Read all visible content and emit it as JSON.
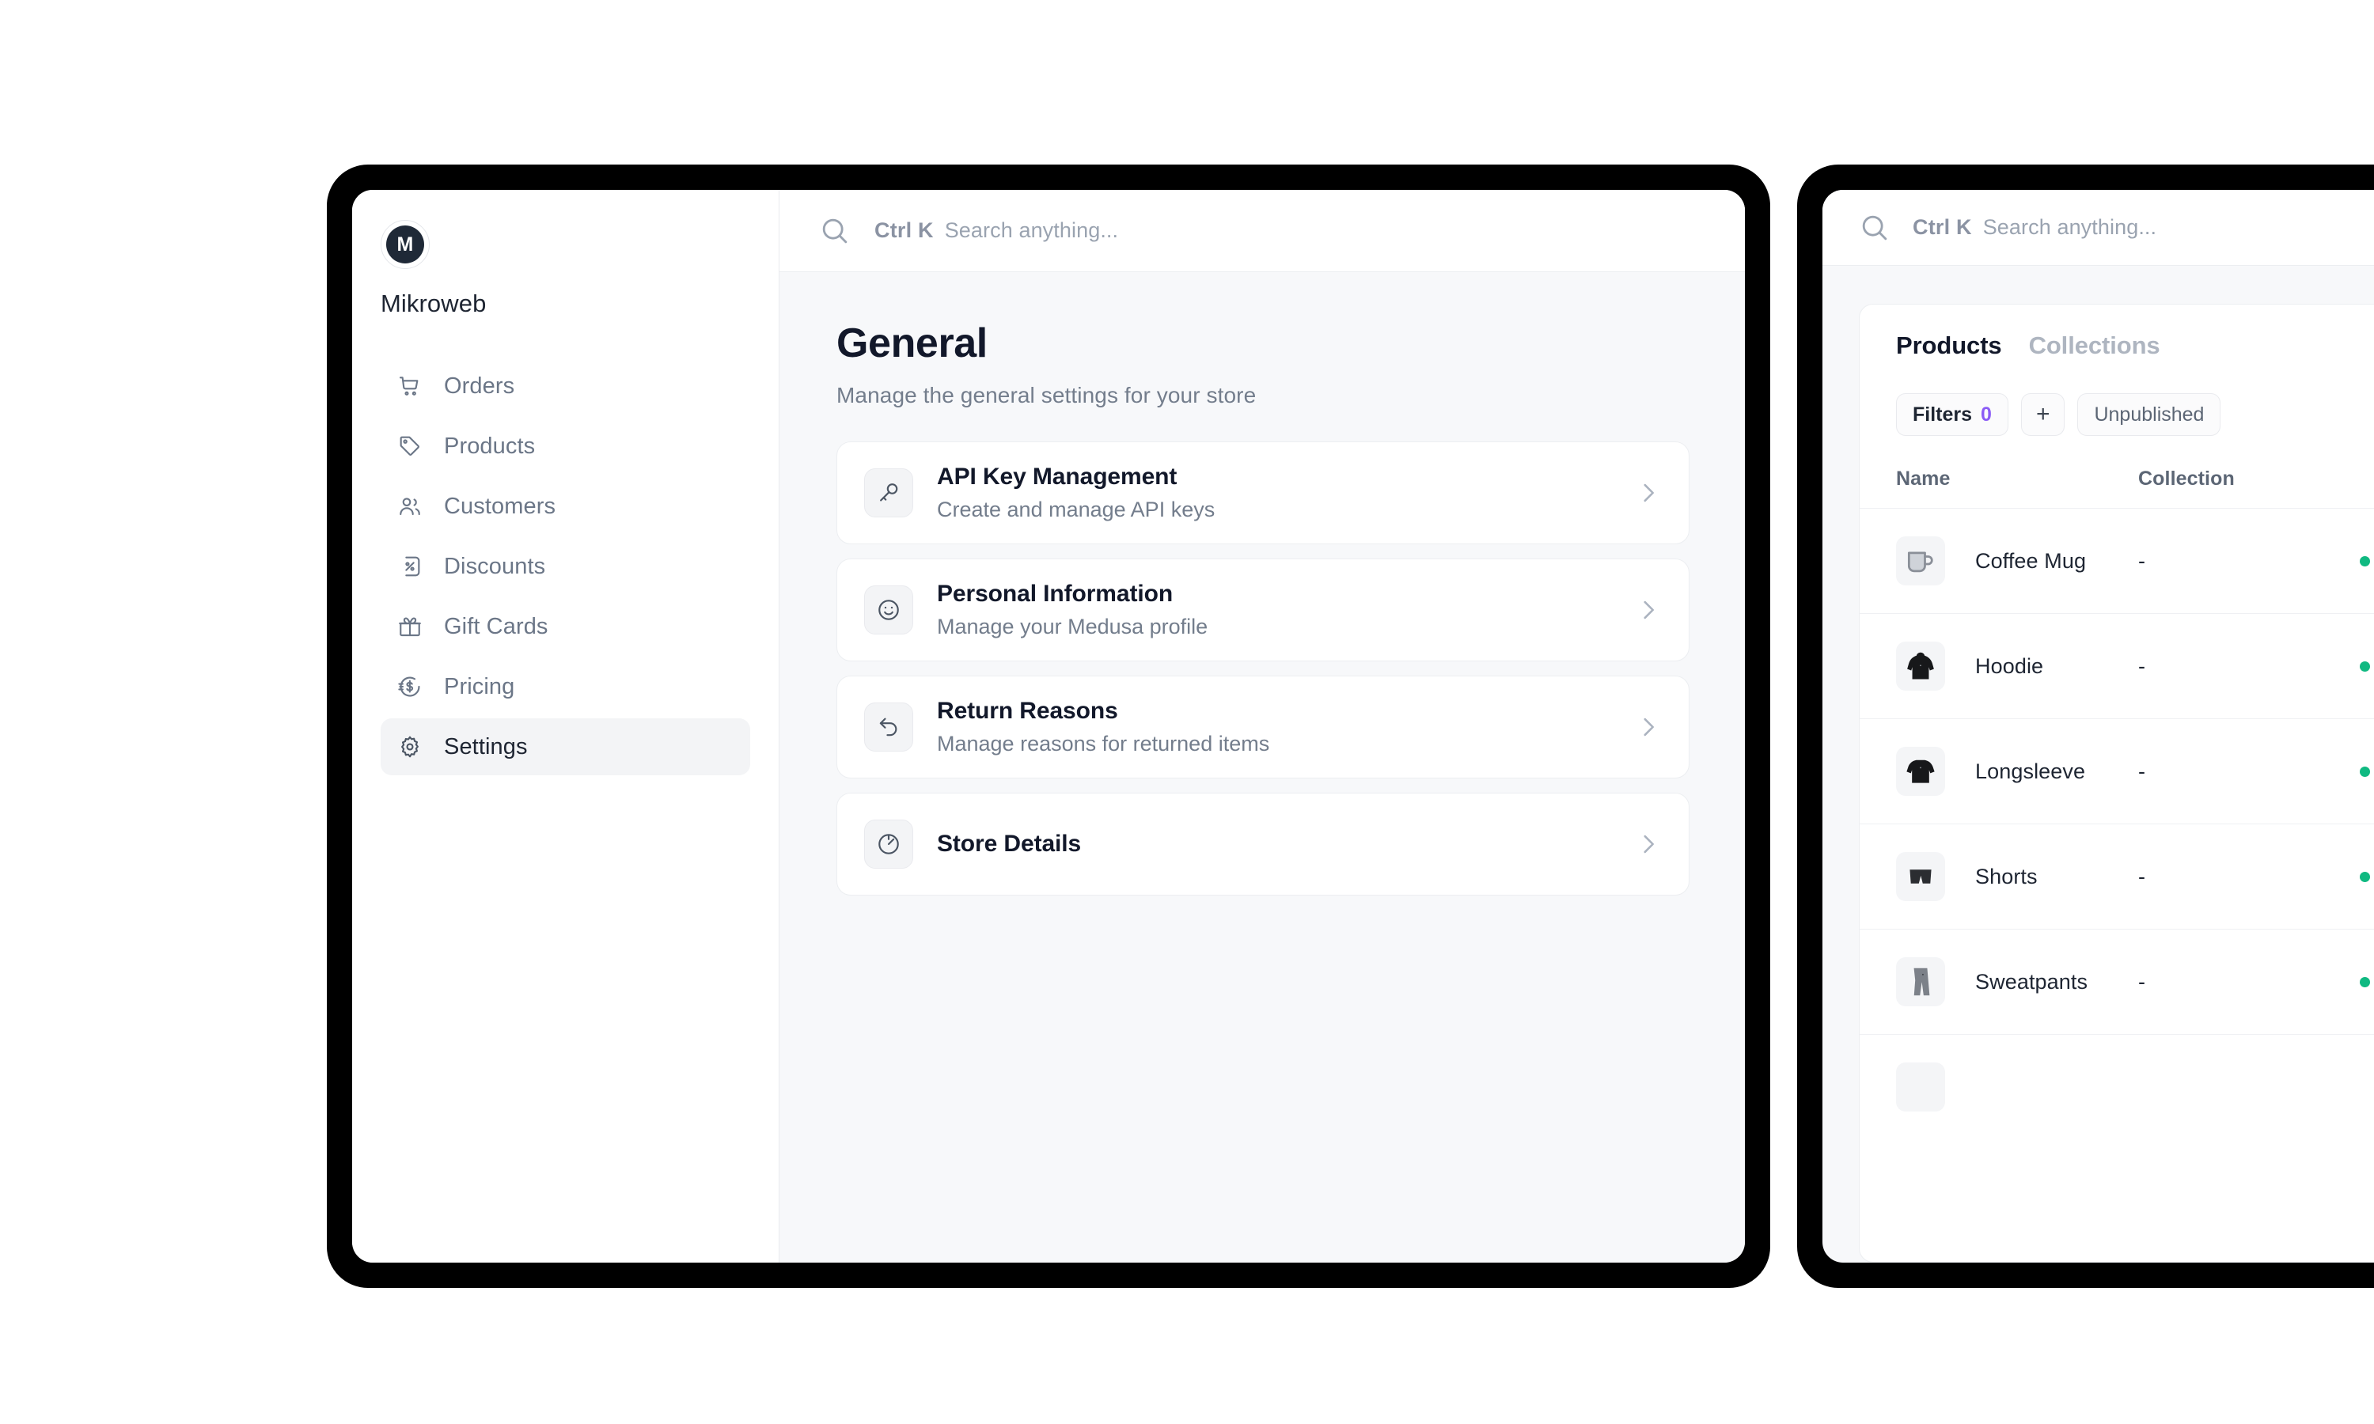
{
  "left_device": {
    "sidebar": {
      "avatar_initial": "M",
      "brand_name": "Mikroweb",
      "items": [
        {
          "label": "Orders",
          "icon": "cart-icon",
          "active": false
        },
        {
          "label": "Products",
          "icon": "tag-icon",
          "active": false
        },
        {
          "label": "Customers",
          "icon": "users-icon",
          "active": false
        },
        {
          "label": "Discounts",
          "icon": "percent-icon",
          "active": false
        },
        {
          "label": "Gift Cards",
          "icon": "gift-icon",
          "active": false
        },
        {
          "label": "Pricing",
          "icon": "dollar-icon",
          "active": false
        },
        {
          "label": "Settings",
          "icon": "gear-icon",
          "active": true
        }
      ]
    },
    "search": {
      "shortcut": "Ctrl K",
      "placeholder": "Search anything...",
      "icon": "search-icon"
    },
    "page": {
      "title": "General",
      "subtitle": "Manage the general settings for your store"
    },
    "cards": [
      {
        "title": "API Key Management",
        "desc": "Create and manage API keys",
        "icon": "key-icon"
      },
      {
        "title": "Personal Information",
        "desc": "Manage your Medusa profile",
        "icon": "smiley-icon"
      },
      {
        "title": "Return Reasons",
        "desc": "Manage reasons for returned items",
        "icon": "undo-icon"
      },
      {
        "title": "Store Details",
        "desc": "",
        "icon": "compass-icon"
      }
    ]
  },
  "right_device": {
    "search": {
      "shortcut": "Ctrl K",
      "placeholder": "Search anything...",
      "icon": "search-icon"
    },
    "tabs": [
      {
        "label": "Products",
        "active": true
      },
      {
        "label": "Collections",
        "active": false
      }
    ],
    "filters": {
      "label": "Filters",
      "count": "0",
      "add_label": "+",
      "unpublished_label": "Unpublished",
      "count_color": "#8b5cf6"
    },
    "table": {
      "columns": [
        "Name",
        "Collection"
      ],
      "rows": [
        {
          "name": "Coffee Mug",
          "collection": "-",
          "thumb": "mug-icon"
        },
        {
          "name": "Hoodie",
          "collection": "-",
          "thumb": "hoodie-icon"
        },
        {
          "name": "Longsleeve",
          "collection": "-",
          "thumb": "longsleeve-icon"
        },
        {
          "name": "Shorts",
          "collection": "-",
          "thumb": "shorts-icon"
        },
        {
          "name": "Sweatpants",
          "collection": "-",
          "thumb": "sweatpants-icon"
        },
        {
          "name": "",
          "collection": "",
          "thumb": "product-icon"
        }
      ]
    }
  }
}
